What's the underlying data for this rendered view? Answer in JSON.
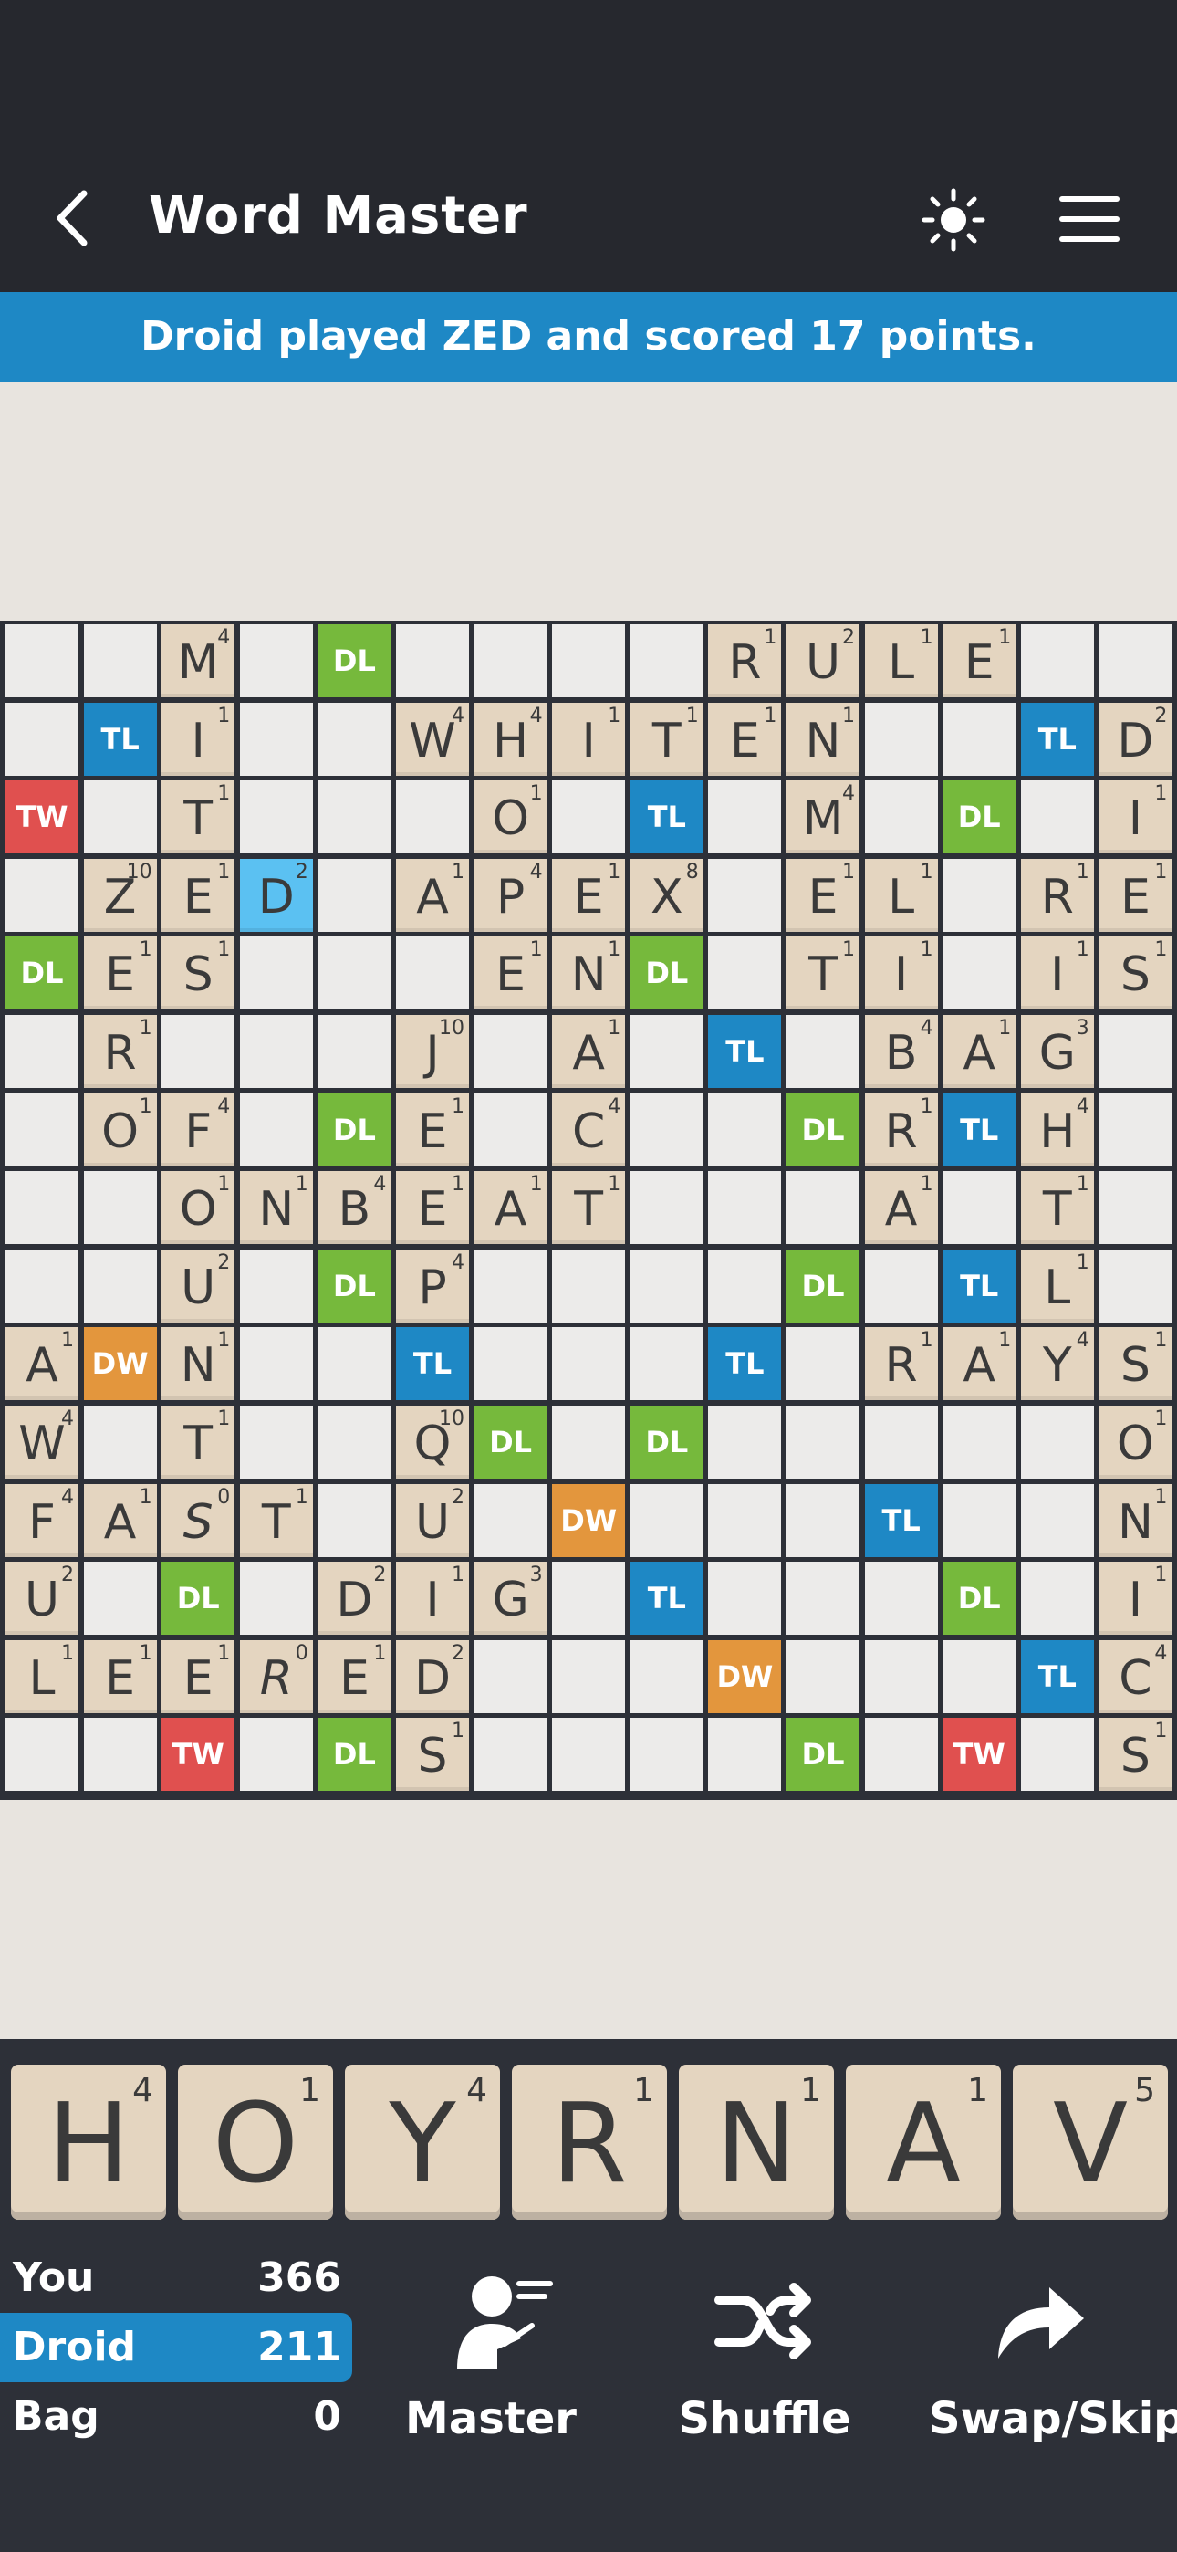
{
  "header": {
    "title": "Word Master"
  },
  "banner": {
    "message": "Droid played ZED and scored 17 points."
  },
  "board": {
    "rows": [
      [
        "",
        "",
        "M4",
        "",
        "DL",
        "",
        "",
        "",
        "",
        "R1",
        "U2",
        "L1",
        "E1",
        "",
        ""
      ],
      [
        "",
        "TL",
        "I1",
        "",
        "",
        "W4",
        "H4",
        "I1",
        "T1",
        "E1",
        "N1",
        "",
        "",
        "TL",
        "D2"
      ],
      [
        "TW",
        "",
        "T1",
        "",
        "",
        "",
        "O1",
        "",
        "TL",
        "",
        "M4",
        "",
        "DL",
        "",
        "I1"
      ],
      [
        "",
        "Z10",
        "E1",
        "D2*",
        "",
        "A1",
        "P4",
        "E1",
        "X8",
        "",
        "E1",
        "L1",
        "",
        "R1",
        "E1"
      ],
      [
        "DL",
        "E1",
        "S1",
        "",
        "",
        "",
        "E1",
        "N1",
        "DL",
        "",
        "T1",
        "I1",
        "",
        "I1",
        "S1"
      ],
      [
        "",
        "R1",
        "",
        "",
        "",
        "J10",
        "",
        "A1",
        "",
        "TL",
        "",
        "B4",
        "A1",
        "G3",
        ""
      ],
      [
        "",
        "O1",
        "F4",
        "",
        "DL",
        "E1",
        "",
        "C4",
        "",
        "",
        "DL",
        "R1",
        "TL",
        "H4",
        ""
      ],
      [
        "",
        "",
        "O1",
        "N1",
        "B4",
        "E1",
        "A1",
        "T1",
        "",
        "",
        "",
        "A1",
        "",
        "T1",
        ""
      ],
      [
        "",
        "",
        "U2",
        "",
        "DL",
        "P4",
        "",
        "",
        "",
        "",
        "DL",
        "",
        "TL",
        "L1",
        ""
      ],
      [
        "A1",
        "DW",
        "N1",
        "",
        "",
        "TL",
        "",
        "",
        "",
        "TL",
        "",
        "R1",
        "A1",
        "Y4",
        "S1"
      ],
      [
        "W4",
        "",
        "T1",
        "",
        "",
        "Q10",
        "DL",
        "",
        "DL",
        "",
        "",
        "",
        "",
        "",
        "O1"
      ],
      [
        "F4",
        "A1",
        "S0",
        "T1",
        "",
        "U2",
        "",
        "DW",
        "",
        "",
        "",
        "TL",
        "",
        "",
        "N1"
      ],
      [
        "U2",
        "",
        "DL",
        "",
        "D2",
        "I1",
        "G3",
        "",
        "TL",
        "",
        "",
        "",
        "DL",
        "",
        "I1"
      ],
      [
        "L1",
        "E1",
        "E1",
        "R0",
        "E1",
        "D2",
        "",
        "",
        "",
        "DW",
        "",
        "",
        "",
        "TL",
        "C4"
      ],
      [
        "",
        "",
        "TW",
        "",
        "DL",
        "S1",
        "",
        "",
        "",
        "",
        "DL",
        "",
        "TW",
        "",
        "S1"
      ]
    ]
  },
  "rack": [
    {
      "letter": "H",
      "points": "4"
    },
    {
      "letter": "O",
      "points": "1"
    },
    {
      "letter": "Y",
      "points": "4"
    },
    {
      "letter": "R",
      "points": "1"
    },
    {
      "letter": "N",
      "points": "1"
    },
    {
      "letter": "A",
      "points": "1"
    },
    {
      "letter": "V",
      "points": "5"
    }
  ],
  "scores": [
    {
      "name": "You",
      "value": "366",
      "active": false
    },
    {
      "name": "Droid",
      "value": "211",
      "active": true
    },
    {
      "name": "Bag",
      "value": "0",
      "active": false
    }
  ],
  "actions": {
    "master": {
      "label": "Master",
      "icon": "master-player-icon"
    },
    "shuffle": {
      "label": "Shuffle",
      "icon": "shuffle-icon"
    },
    "swap": {
      "label": "Swap/Skip",
      "icon": "swap-skip-arrow-icon"
    }
  },
  "colors": {
    "topbar": "#26282e",
    "banner": "#1e88c5",
    "tile": "#e4d5c0",
    "last_played_tile": "#5bc1f2",
    "TL": "#1e88c5",
    "DL": "#76b93c",
    "TW": "#e0504f",
    "DW": "#e3963d"
  }
}
